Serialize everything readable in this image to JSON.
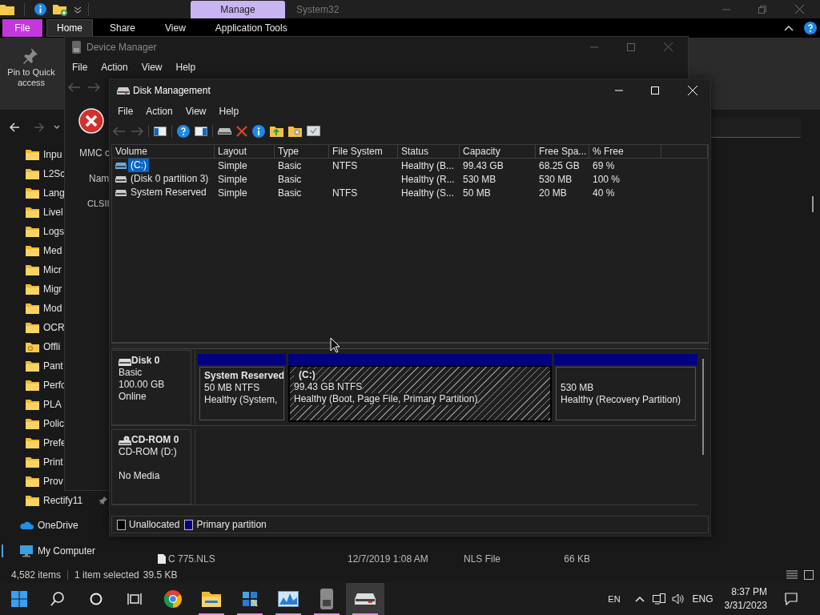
{
  "explorer": {
    "context_tab": "Manage",
    "title": "System32",
    "ribbon_tabs": [
      {
        "label": "File",
        "kind": "file",
        "selected": false
      },
      {
        "label": "Home",
        "kind": "tab",
        "selected": true
      },
      {
        "label": "Share",
        "kind": "tab",
        "selected": false
      },
      {
        "label": "View",
        "kind": "tab",
        "selected": false
      },
      {
        "label": "Application Tools",
        "kind": "tab",
        "selected": false
      }
    ],
    "ribbon_button": "Pin to Quick access",
    "nav_items": [
      {
        "label": "Inpu",
        "kind": "folder",
        "selected": false
      },
      {
        "label": "L2Sc",
        "kind": "folder",
        "selected": false
      },
      {
        "label": "Lang",
        "kind": "folder",
        "selected": false
      },
      {
        "label": "Livel",
        "kind": "folder",
        "selected": false
      },
      {
        "label": "Logs",
        "kind": "folder",
        "selected": false
      },
      {
        "label": "Med",
        "kind": "folder",
        "selected": false
      },
      {
        "label": "Micr",
        "kind": "folder",
        "selected": false
      },
      {
        "label": "Migr",
        "kind": "folder",
        "selected": false
      },
      {
        "label": "Mod",
        "kind": "folder",
        "selected": false
      },
      {
        "label": "OCR",
        "kind": "folder",
        "selected": false
      },
      {
        "label": "Offli",
        "kind": "sync-folder",
        "selected": false
      },
      {
        "label": "Pant",
        "kind": "folder",
        "selected": false
      },
      {
        "label": "Perfo",
        "kind": "folder",
        "selected": false
      },
      {
        "label": "PLA",
        "kind": "folder",
        "selected": false
      },
      {
        "label": "Polic",
        "kind": "folder",
        "selected": false
      },
      {
        "label": "Prefe",
        "kind": "folder",
        "selected": false
      },
      {
        "label": "Print",
        "kind": "folder",
        "selected": false
      },
      {
        "label": "Prov",
        "kind": "folder",
        "selected": false
      },
      {
        "label": "Rectify11",
        "kind": "pinned-folder",
        "selected": false
      },
      {
        "label": "OneDrive",
        "kind": "cloud",
        "selected": false
      },
      {
        "label": "My Computer",
        "kind": "computer",
        "selected": true
      }
    ],
    "file_row": {
      "name": "C 775.NLS",
      "date": "12/7/2019 1:08 AM",
      "type": "NLS File",
      "size": "66 KB"
    },
    "status": {
      "items": "4,582 items",
      "selection": "1 item selected",
      "size": "39.5 KB"
    }
  },
  "device_manager": {
    "title": "Device Manager",
    "menus": [
      "File",
      "Action",
      "View",
      "Help"
    ],
    "error_texts": [
      "MMC c",
      "Nam",
      "CLSII"
    ]
  },
  "disk_management": {
    "title": "Disk Management",
    "menus": [
      "File",
      "Action",
      "View",
      "Help"
    ],
    "columns": [
      "Volume",
      "Layout",
      "Type",
      "File System",
      "Status",
      "Capacity",
      "Free Spa...",
      "% Free"
    ],
    "rows": [
      {
        "selected": true,
        "cells": [
          "(C:)",
          "Simple",
          "Basic",
          "NTFS",
          "Healthy (B...",
          "99.43 GB",
          "68.25 GB",
          "69 %"
        ]
      },
      {
        "selected": false,
        "cells": [
          "(Disk 0 partition 3)",
          "Simple",
          "Basic",
          null,
          "Healthy (R...",
          "530 MB",
          "530 MB",
          "100 %"
        ]
      },
      {
        "selected": false,
        "cells": [
          "System Reserved",
          "Simple",
          "Basic",
          "NTFS",
          "Healthy (S...",
          "50 MB",
          "20 MB",
          "40 %"
        ]
      }
    ],
    "disks": [
      {
        "kind": "disk",
        "name": "Disk 0",
        "type": "Basic",
        "size": "100.00 GB",
        "status": "Online",
        "partitions": [
          {
            "label": "System Reserved",
            "size": "50 MB NTFS",
            "status": "Healthy (System,",
            "selected": false
          },
          {
            "label": "(C:)",
            "size": "99.43 GB NTFS",
            "status": "Healthy (Boot, Page File, Primary Partition)",
            "selected": true
          },
          {
            "size": "530 MB",
            "status": "Healthy (Recovery Partition)",
            "selected": false
          }
        ]
      },
      {
        "kind": "cdrom",
        "name": "CD-ROM 0",
        "type": "CD-ROM (D:)",
        "status": "No Media"
      }
    ],
    "legend": [
      {
        "label": "Unallocated",
        "color": "#000000"
      },
      {
        "label": "Primary partition",
        "color": "#000080"
      }
    ]
  },
  "taskbar": {
    "apps": [
      {
        "kind": "chrome",
        "running": false,
        "active": false
      },
      {
        "kind": "explorer",
        "running": true,
        "active": false
      },
      {
        "kind": "tiles",
        "running": true,
        "active": false
      },
      {
        "kind": "monitor",
        "running": true,
        "active": false
      },
      {
        "kind": "device",
        "running": true,
        "active": false
      },
      {
        "kind": "disk",
        "running": true,
        "active": true
      }
    ],
    "language": "EN",
    "input": "ENG",
    "time": "8:37 PM",
    "date": "3/31/2023"
  }
}
